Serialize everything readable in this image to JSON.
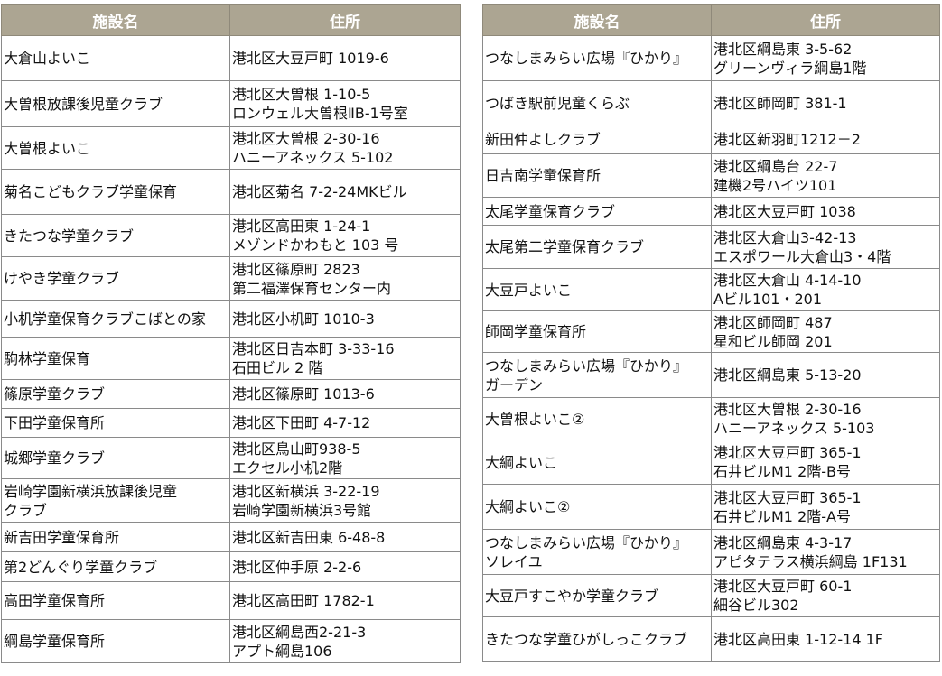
{
  "headers": {
    "name": "施設名",
    "address": "住所"
  },
  "left_table": [
    {
      "name": "大倉山よいこ",
      "address": "港北区大豆戸町 1019-6"
    },
    {
      "name": "大曽根放課後児童クラブ",
      "address": "港北区大曽根 1-10-5\nロンウェル大曽根ⅡB-1号室"
    },
    {
      "name": "大曽根よいこ",
      "address": "港北区大曽根 2-30-16\nハニーアネックス 5-102"
    },
    {
      "name": "菊名こどもクラブ学童保育",
      "address": "港北区菊名 7-2-24MKビル"
    },
    {
      "name": "きたつな学童クラブ",
      "address": "港北区高田東 1-24-1\nメゾンドかわもと 103 号"
    },
    {
      "name": "けやき学童クラブ",
      "address": "港北区篠原町 2823\n第二福澤保育センター内"
    },
    {
      "name": "小机学童保育クラブこばとの家",
      "address": "港北区小机町 1010-3"
    },
    {
      "name": "駒林学童保育",
      "address": "港北区日吉本町 3-33-16\n石田ビル 2 階"
    },
    {
      "name": "篠原学童クラブ",
      "address": "港北区篠原町 1013-6"
    },
    {
      "name": "下田学童保育所",
      "address": "港北区下田町 4-7-12"
    },
    {
      "name": "城郷学童クラブ",
      "address": "港北区鳥山町938-5\nエクセル小机2階"
    },
    {
      "name": "岩崎学園新横浜放課後児童\nクラブ",
      "address": "港北区新横浜 3-22-19\n岩崎学園新横浜3号館"
    },
    {
      "name": "新吉田学童保育所",
      "address": "港北区新吉田東 6-48-8"
    },
    {
      "name": "第2どんぐり学童クラブ",
      "address": "港北区仲手原 2-2-6"
    },
    {
      "name": "高田学童保育所",
      "address": "港北区高田町 1782-1"
    },
    {
      "name": "綱島学童保育所",
      "address": "港北区綱島西2-21-3\nアプト綱島106"
    }
  ],
  "right_table": [
    {
      "name": "つなしまみらい広場『ひかり』",
      "address": "港北区綱島東 3-5-62\nグリーンヴィラ綱島1階"
    },
    {
      "name": "つばき駅前児童くらぶ",
      "address": "港北区師岡町 381-1"
    },
    {
      "name": "新田仲よしクラブ",
      "address": "港北区新羽町1212－2"
    },
    {
      "name": "日吉南学童保育所",
      "address": "港北区綱島台 22-7\n建機2号ハイツ101"
    },
    {
      "name": "太尾学童保育クラブ",
      "address": "港北区大豆戸町 1038"
    },
    {
      "name": "太尾第二学童保育クラブ",
      "address": "港北区大倉山3-42-13\nエスポワール大倉山3・4階"
    },
    {
      "name": "大豆戸よいこ",
      "address": "港北区大倉山 4-14-10\nAビル101・201"
    },
    {
      "name": "師岡学童保育所",
      "address": "港北区師岡町 487\n星和ビル師岡 201"
    },
    {
      "name": "つなしまみらい広場『ひかり』\nガーデン",
      "address": "港北区綱島東 5-13-20"
    },
    {
      "name": "大曽根よいこ②",
      "address": "港北区大曽根 2-30-16\nハニーアネックス 5-103"
    },
    {
      "name": "大綱よいこ",
      "address": "港北区大豆戸町 365-1\n石井ビルM1 2階-B号"
    },
    {
      "name": "大綱よいこ②",
      "address": "港北区大豆戸町 365-1\n石井ビルM1 2階-A号"
    },
    {
      "name": "つなしまみらい広場『ひかり』\nソレイユ",
      "address": "港北区綱島東 4-3-17\nアピタテラス横浜綱島 1F131"
    },
    {
      "name": "大豆戸すこやか学童クラブ",
      "address": "港北区大豆戸町 60-1\n細谷ビル302"
    },
    {
      "name": "きたつな学童ひがしっこクラブ",
      "address": "港北区高田東 1-12-14 1F"
    }
  ]
}
